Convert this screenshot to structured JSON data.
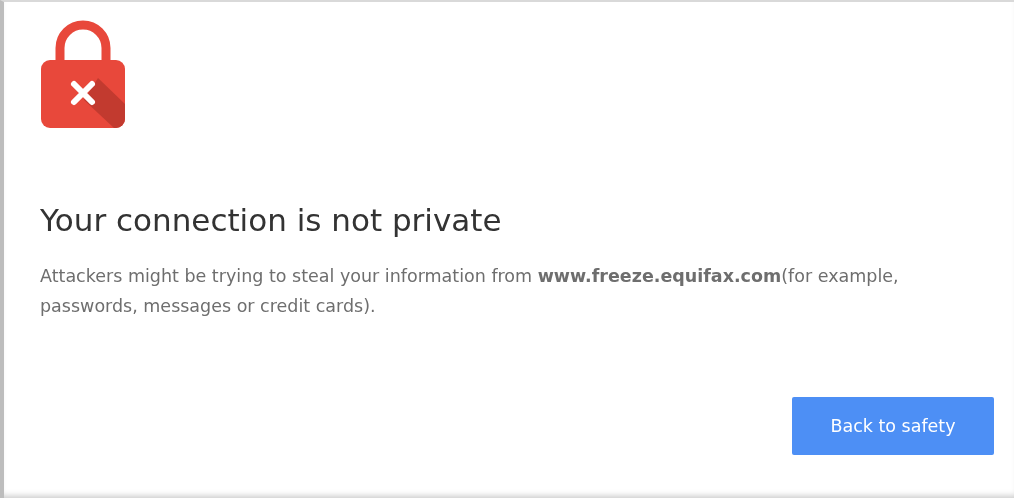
{
  "heading": "Your connection is not private",
  "message": "Attackers might be trying to steal your information from **www.freeze.equifax.com**(for example, passwords, messages or credit cards).",
  "buttons": [
    {
      "label": "Back to safety",
      "kind": "primary"
    }
  ]
}
